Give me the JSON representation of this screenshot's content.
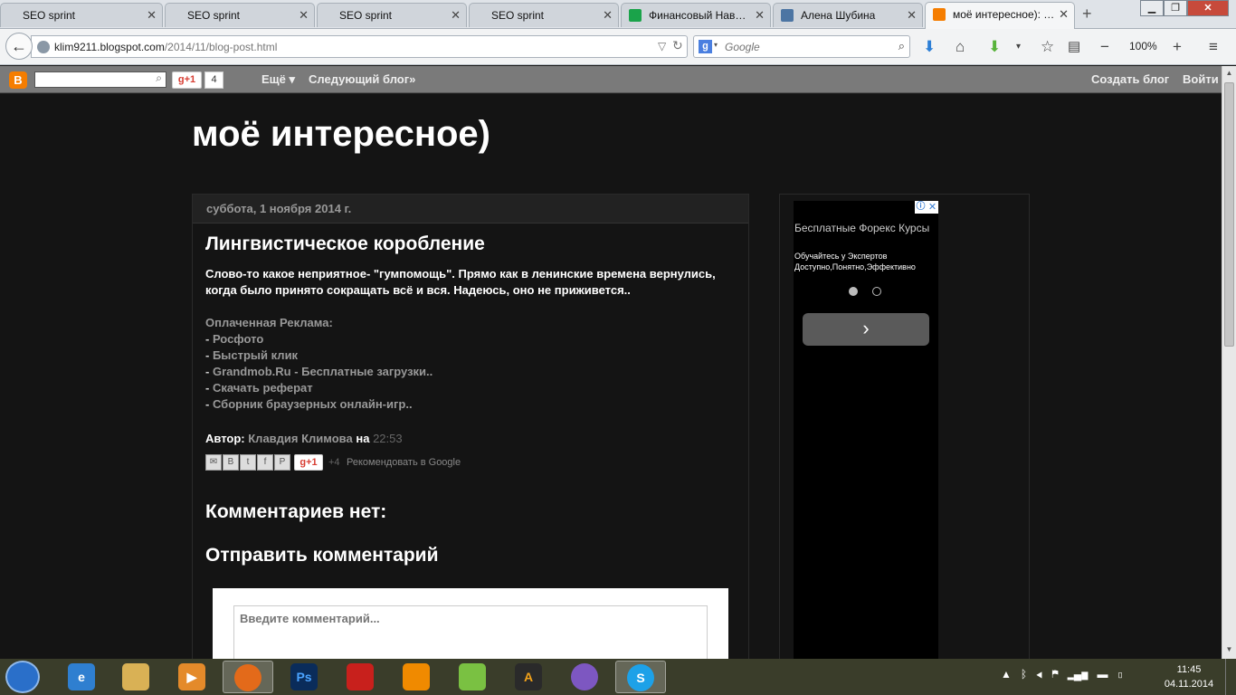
{
  "browser": {
    "tabs": [
      {
        "title": "SEO sprint",
        "favicon_color": "#f2f3f4"
      },
      {
        "title": "SEO sprint",
        "favicon_color": "#f2f3f4"
      },
      {
        "title": "SEO sprint",
        "favicon_color": "#f2f3f4"
      },
      {
        "title": "SEO sprint",
        "favicon_color": "#f2f3f4"
      },
      {
        "title": "Финансовый Нав…",
        "favicon_color": "#1aa34a"
      },
      {
        "title": "Алена Шубина",
        "favicon_color": "#4c75a3"
      },
      {
        "title": "моё интересное): …",
        "favicon_color": "#f57d00",
        "active": true
      }
    ],
    "url_host": "klim9211.blogspot.com",
    "url_path": "/2014/11/blog-post.html",
    "search_placeholder": "Google",
    "zoom": "100%",
    "tab_close_glyph": "✕",
    "newtab_glyph": "+"
  },
  "blogger_bar": {
    "gplus_label": "g+1",
    "gplus_count": "4",
    "more_label": "Ещё ▾",
    "next_blog_label": "Следующий блог»",
    "create_blog_label": "Создать блог",
    "login_label": "Войти"
  },
  "blog": {
    "title": "моё интересное)",
    "date_header": "суббота, 1 ноября 2014 г.",
    "post_title": "Лингвистическое коробление",
    "post_body": "Слово-то какое неприятное- \"гумпомощь\". Прямо как в ленинские времена вернулись, когда было принято сокращать всё и вся. Надеюсь, оно не приживется..",
    "ads_label": "Оплаченная Реклама:",
    "ads": [
      {
        "prefix": "- ",
        "link": "Росфото",
        "suffix": ""
      },
      {
        "prefix": "- ",
        "link": "Быстрый клик",
        "suffix": ""
      },
      {
        "prefix": "- ",
        "link": "Grandmob.Ru",
        "suffix": " - Бесплатные загрузки.."
      },
      {
        "prefix": "- ",
        "link": "Скачать реферат",
        "suffix": ""
      },
      {
        "prefix": "- ",
        "link": "Сборник браузерных онлайн-игр..",
        "suffix": ""
      }
    ],
    "author_label": "Автор:",
    "author_name": "Клавдия Климова",
    "author_on": "на",
    "post_time": "22:53",
    "share_gplus": "g+1",
    "share_count": "+4",
    "share_recommend": "Рекомендовать в Google",
    "no_comments": "Комментариев нет:",
    "post_comment": "Отправить комментарий",
    "comment_placeholder": "Введите комментарий..."
  },
  "sidebar_ad": {
    "info_icon": "ⓘ",
    "close_icon": "✕",
    "headline": "Бесплатные Форекс Курсы",
    "line1": "Обучайтесь у Экспертов",
    "line2": "Доступно,Понятно,Эффективно",
    "next_icon": "›"
  },
  "taskbar": {
    "apps": [
      "internet-explorer",
      "file-explorer",
      "media-player",
      "firefox",
      "photoshop",
      "filezilla",
      "vlc",
      "evernote",
      "aimp",
      "viber",
      "skype"
    ],
    "photoshop_label": "Ps",
    "aimp_label": "A",
    "skype_label": "S",
    "time": "11:45",
    "date": "04.11.2014"
  }
}
